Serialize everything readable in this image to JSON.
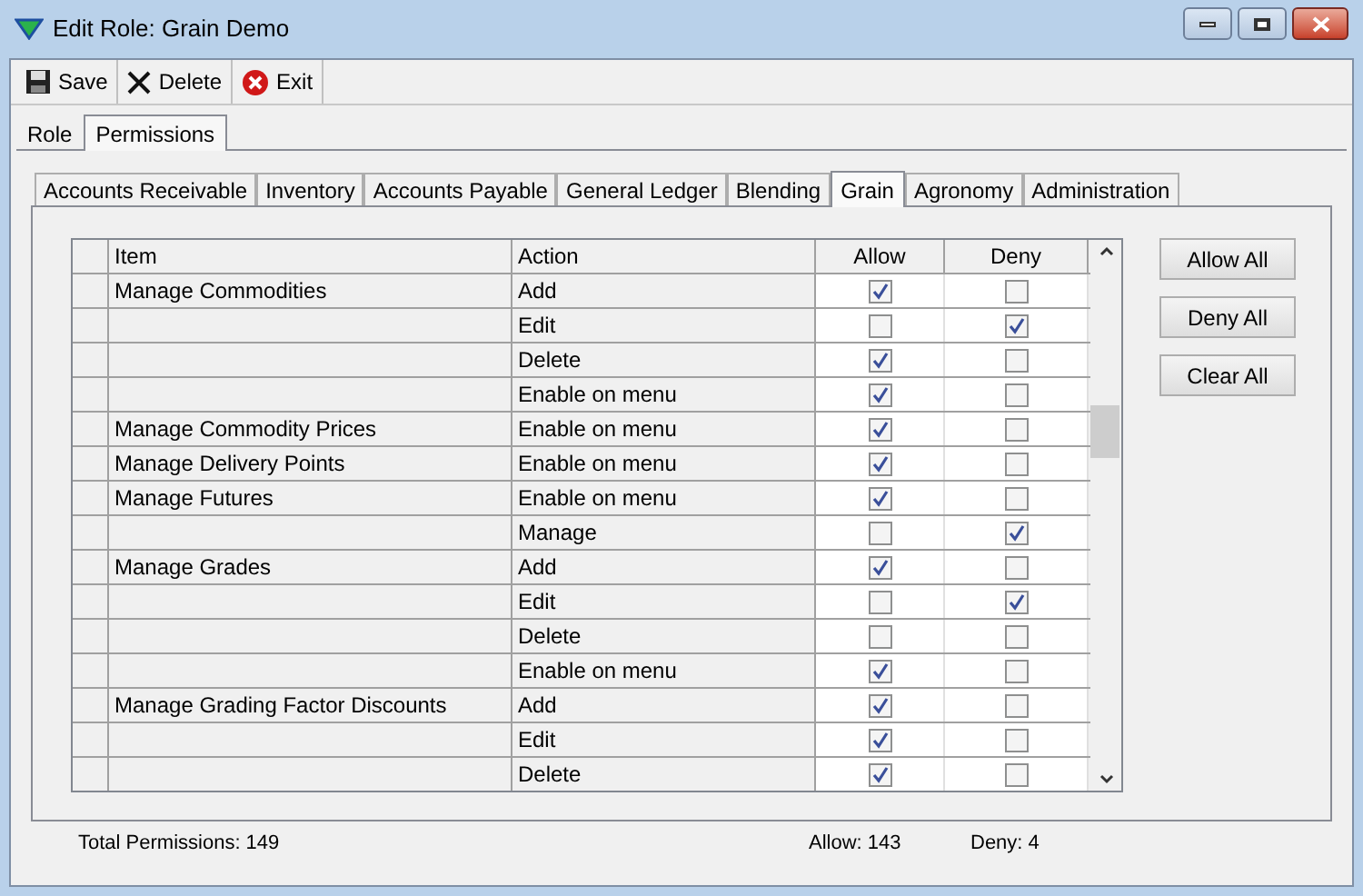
{
  "window": {
    "title": "Edit Role: Grain Demo"
  },
  "toolbar": [
    {
      "kind": "save",
      "label": "Save"
    },
    {
      "kind": "delete",
      "label": "Delete"
    },
    {
      "kind": "exit",
      "label": "Exit"
    }
  ],
  "tabs": [
    {
      "label": "Role",
      "selected": false
    },
    {
      "label": "Permissions",
      "selected": true
    }
  ],
  "module_tabs": [
    {
      "label": "Accounts Receivable",
      "selected": false
    },
    {
      "label": "Inventory",
      "selected": false
    },
    {
      "label": "Accounts Payable",
      "selected": false
    },
    {
      "label": "General Ledger",
      "selected": false
    },
    {
      "label": "Blending",
      "selected": false
    },
    {
      "label": "Grain",
      "selected": true
    },
    {
      "label": "Agronomy",
      "selected": false
    },
    {
      "label": "Administration",
      "selected": false
    }
  ],
  "table": {
    "columns": [
      "Item",
      "Action",
      "Allow",
      "Deny"
    ],
    "rows": [
      {
        "item": "Manage Commodities",
        "action": "Add",
        "allow": true,
        "deny": false
      },
      {
        "item": "",
        "action": "Edit",
        "allow": false,
        "deny": true
      },
      {
        "item": "",
        "action": "Delete",
        "allow": true,
        "deny": false
      },
      {
        "item": "",
        "action": "Enable on menu",
        "allow": true,
        "deny": false
      },
      {
        "item": "Manage Commodity Prices",
        "action": "Enable on menu",
        "allow": true,
        "deny": false
      },
      {
        "item": "Manage Delivery Points",
        "action": "Enable on menu",
        "allow": true,
        "deny": false
      },
      {
        "item": "Manage Futures",
        "action": "Enable on menu",
        "allow": true,
        "deny": false
      },
      {
        "item": "",
        "action": "Manage",
        "allow": false,
        "deny": true
      },
      {
        "item": "Manage Grades",
        "action": "Add",
        "allow": true,
        "deny": false
      },
      {
        "item": "",
        "action": "Edit",
        "allow": false,
        "deny": true
      },
      {
        "item": "",
        "action": "Delete",
        "allow": false,
        "deny": false
      },
      {
        "item": "",
        "action": "Enable on menu",
        "allow": true,
        "deny": false
      },
      {
        "item": "Manage Grading Factor Discounts",
        "action": "Add",
        "allow": true,
        "deny": false
      },
      {
        "item": "",
        "action": "Edit",
        "allow": true,
        "deny": false
      },
      {
        "item": "",
        "action": "Delete",
        "allow": true,
        "deny": false
      }
    ]
  },
  "buttons": [
    "Allow All",
    "Deny All",
    "Clear All"
  ],
  "status_bar": {
    "total": "Total Permissions: 149",
    "allow": "Allow: 143",
    "deny": "Deny: 4"
  }
}
